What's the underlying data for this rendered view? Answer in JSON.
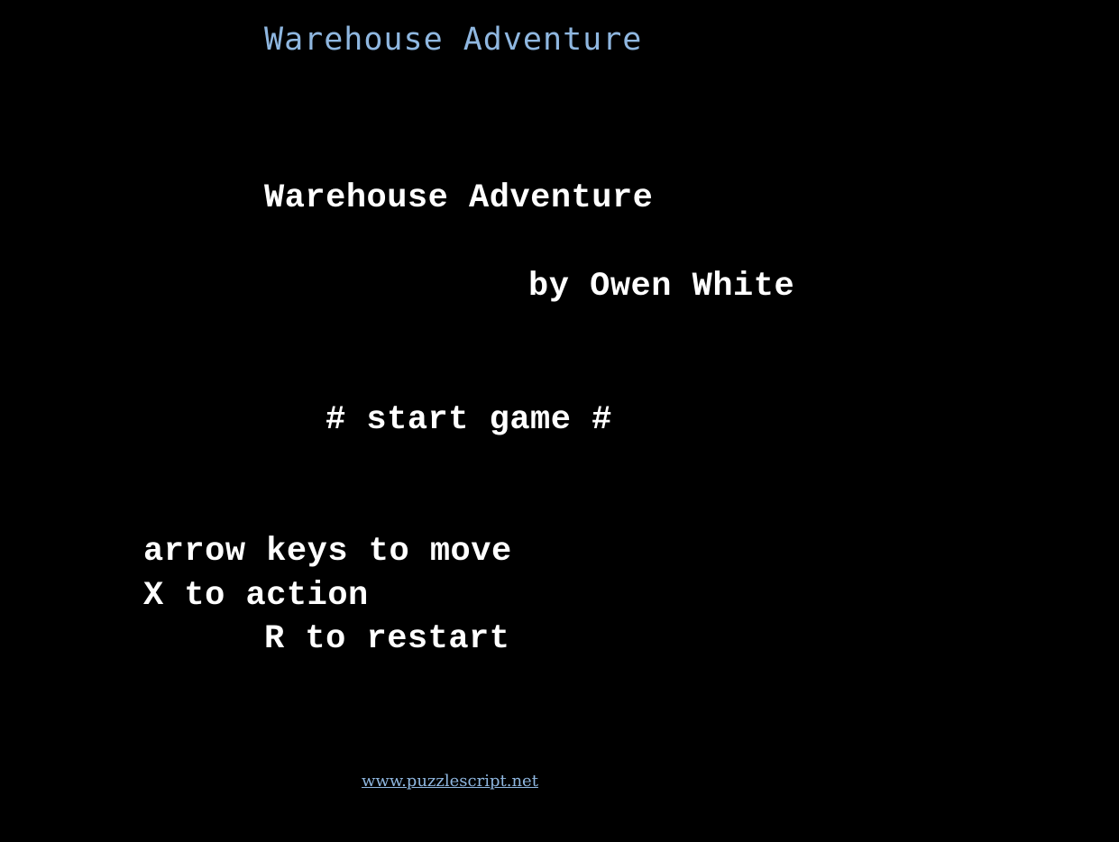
{
  "header": {
    "title": "Warehouse Adventure",
    "color": "#8fb7e0"
  },
  "title_screen": {
    "text_color": "#ffffff",
    "game_title": "Warehouse Adventure",
    "author": "by Owen White",
    "start_option": "# start game #",
    "controls": {
      "move": "arrow keys to move",
      "action": "X to action",
      "restart": "R to restart"
    }
  },
  "footer": {
    "link_text": "www.puzzlescript.net",
    "color": "#8fb7e0"
  }
}
